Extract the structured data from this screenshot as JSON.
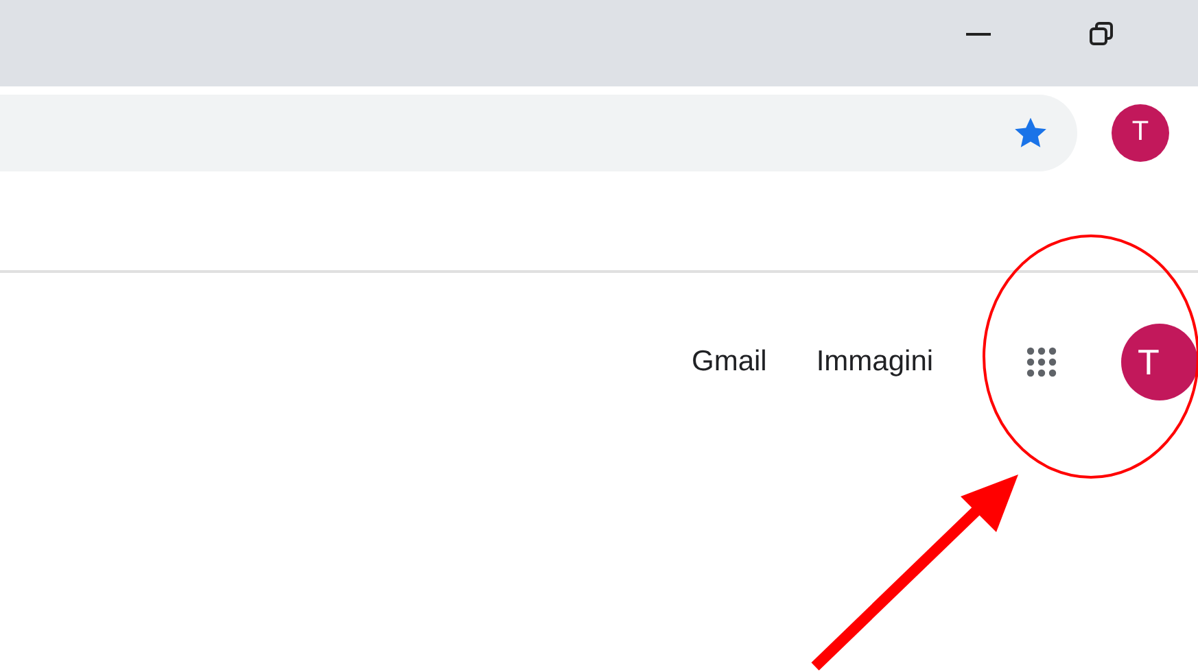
{
  "browser": {
    "profile_avatar": "T"
  },
  "google_bar": {
    "links": [
      "Gmail",
      "Immagini"
    ],
    "account_avatar": "T"
  }
}
